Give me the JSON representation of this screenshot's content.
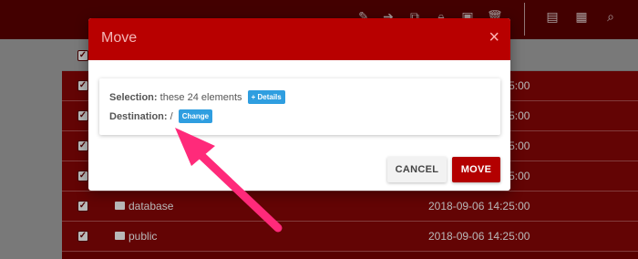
{
  "modal": {
    "title": "Move",
    "close_icon": "×",
    "selection_label": "Selection:",
    "selection_value": "these 24 elements",
    "details_label": "+ Details",
    "destination_label": "Destination:",
    "destination_value": "/",
    "change_label": "Change",
    "cancel_label": "CANCEL",
    "move_label": "MOVE"
  },
  "rows": [
    {
      "name": "",
      "date": "2018-09-06 14:25:00"
    },
    {
      "name": "",
      "date": "2018-09-06 14:25:00"
    },
    {
      "name": "",
      "date": "2018-09-06 14:25:00"
    },
    {
      "name": "",
      "date": "2018-09-06 14:25:00"
    },
    {
      "name": "database",
      "date": "2018-09-06 14:25:00"
    },
    {
      "name": "public",
      "date": "2018-09-06 14:25:00"
    }
  ],
  "colors": {
    "accent": "#b80000",
    "header_bar": "#5e0000",
    "badge": "#2f9ee0",
    "annotation_arrow": "#ff2a7a"
  },
  "icons": {
    "toolbar": [
      "edit-icon",
      "move-icon",
      "copy-icon",
      "lock-icon",
      "extract-icon",
      "trash-icon",
      "new-file-icon",
      "new-folder-icon",
      "search-icon"
    ]
  }
}
